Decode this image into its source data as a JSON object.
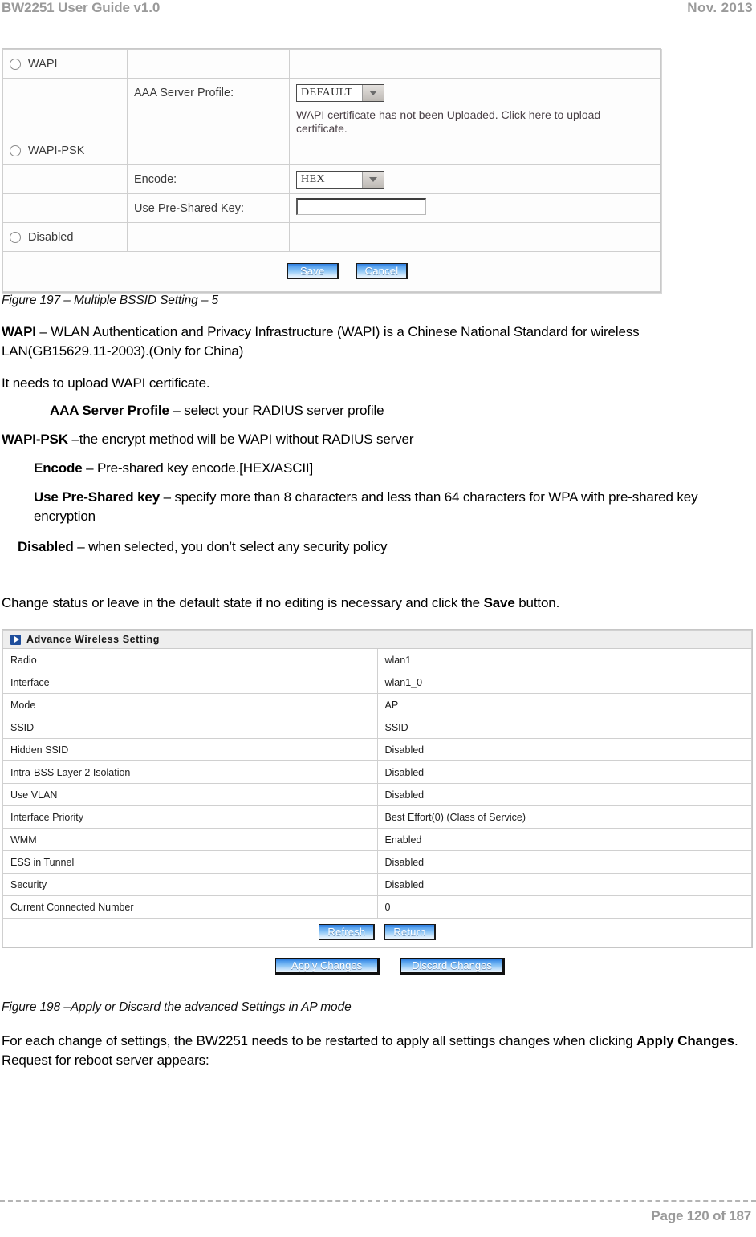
{
  "header": {
    "left": "BW2251 User Guide v1.0",
    "right": "Nov.  2013"
  },
  "wapi_form": {
    "rows": [
      {
        "radio": "WAPI",
        "label": "",
        "control": "none"
      },
      {
        "radio": "",
        "label": "AAA Server Profile:",
        "control": "dropdown",
        "value": "DEFAULT"
      },
      {
        "radio": "",
        "label": "",
        "control": "text",
        "value": "WAPI certificate has not been Uploaded. Click here to upload certificate."
      },
      {
        "radio": "WAPI-PSK",
        "label": "",
        "control": "none"
      },
      {
        "radio": "",
        "label": "Encode:",
        "control": "dropdown",
        "value": "HEX"
      },
      {
        "radio": "",
        "label": "Use Pre-Shared Key:",
        "control": "input",
        "value": ""
      },
      {
        "radio": "Disabled",
        "label": "",
        "control": "none"
      }
    ],
    "buttons": {
      "save": "Save",
      "cancel": "Cancel"
    }
  },
  "figure_197_caption": "Figure 197 – Multiple BSSID Setting – 5",
  "descriptions": {
    "wapi_term": "WAPI",
    "wapi_text": " –  WLAN Authentication and Privacy Infrastructure (WAPI) is a Chinese National Standard for wireless LAN(GB15629.11-2003).(Only for China)",
    "upload_note": "It needs to upload WAPI certificate.",
    "aaa_term": "AAA Server Profile",
    "aaa_text": " – select your RADIUS server profile",
    "wapipsk_term": "WAPI-PSK",
    "wapipsk_text": "  –the encrypt method will be WAPI without RADIUS server",
    "encode_term": "Encode",
    "encode_text": " – Pre-shared key encode.[HEX/ASCII]",
    "psk_term": "Use Pre-Shared key",
    "psk_text": " – specify more than 8 characters and less than 64 characters for WPA with pre-shared key encryption",
    "disabled_term": "Disabled",
    "disabled_text": " – when selected, you don’t select any security policy"
  },
  "change_status": {
    "before": "Change status or leave in the default state if no editing is necessary and click the ",
    "bold": "Save",
    "after": " button."
  },
  "advance_wireless": {
    "title": "Advance Wireless Setting",
    "icon": "arrow-right-icon",
    "rows": [
      {
        "key": "Radio",
        "value": "wlan1"
      },
      {
        "key": "Interface",
        "value": "wlan1_0"
      },
      {
        "key": "Mode",
        "value": "AP"
      },
      {
        "key": "SSID",
        "value": "SSID"
      },
      {
        "key": "Hidden SSID",
        "value": "Disabled"
      },
      {
        "key": "Intra-BSS Layer 2 Isolation",
        "value": "Disabled"
      },
      {
        "key": "Use VLAN",
        "value": "Disabled"
      },
      {
        "key": "Interface Priority",
        "value": "Best Effort(0)  (Class of Service)"
      },
      {
        "key": "WMM",
        "value": "Enabled"
      },
      {
        "key": "ESS in Tunnel",
        "value": "Disabled"
      },
      {
        "key": "Security",
        "value": " Disabled"
      },
      {
        "key": "Current Connected Number",
        "value": "0"
      }
    ],
    "buttons": {
      "refresh": "Refresh",
      "return": "Return"
    }
  },
  "apply_row": {
    "apply": "Apply Changes",
    "discard": "Discard Changes"
  },
  "figure_198_caption": "Figure 198 –Apply or Discard the advanced Settings in AP mode",
  "closing": {
    "before": "For each change of settings, the BW2251 needs to be restarted to apply all settings changes when clicking ",
    "bold": "Apply Changes",
    "after": ". Request for reboot server appears:"
  },
  "footer": {
    "page": "Page 120 of 187"
  }
}
